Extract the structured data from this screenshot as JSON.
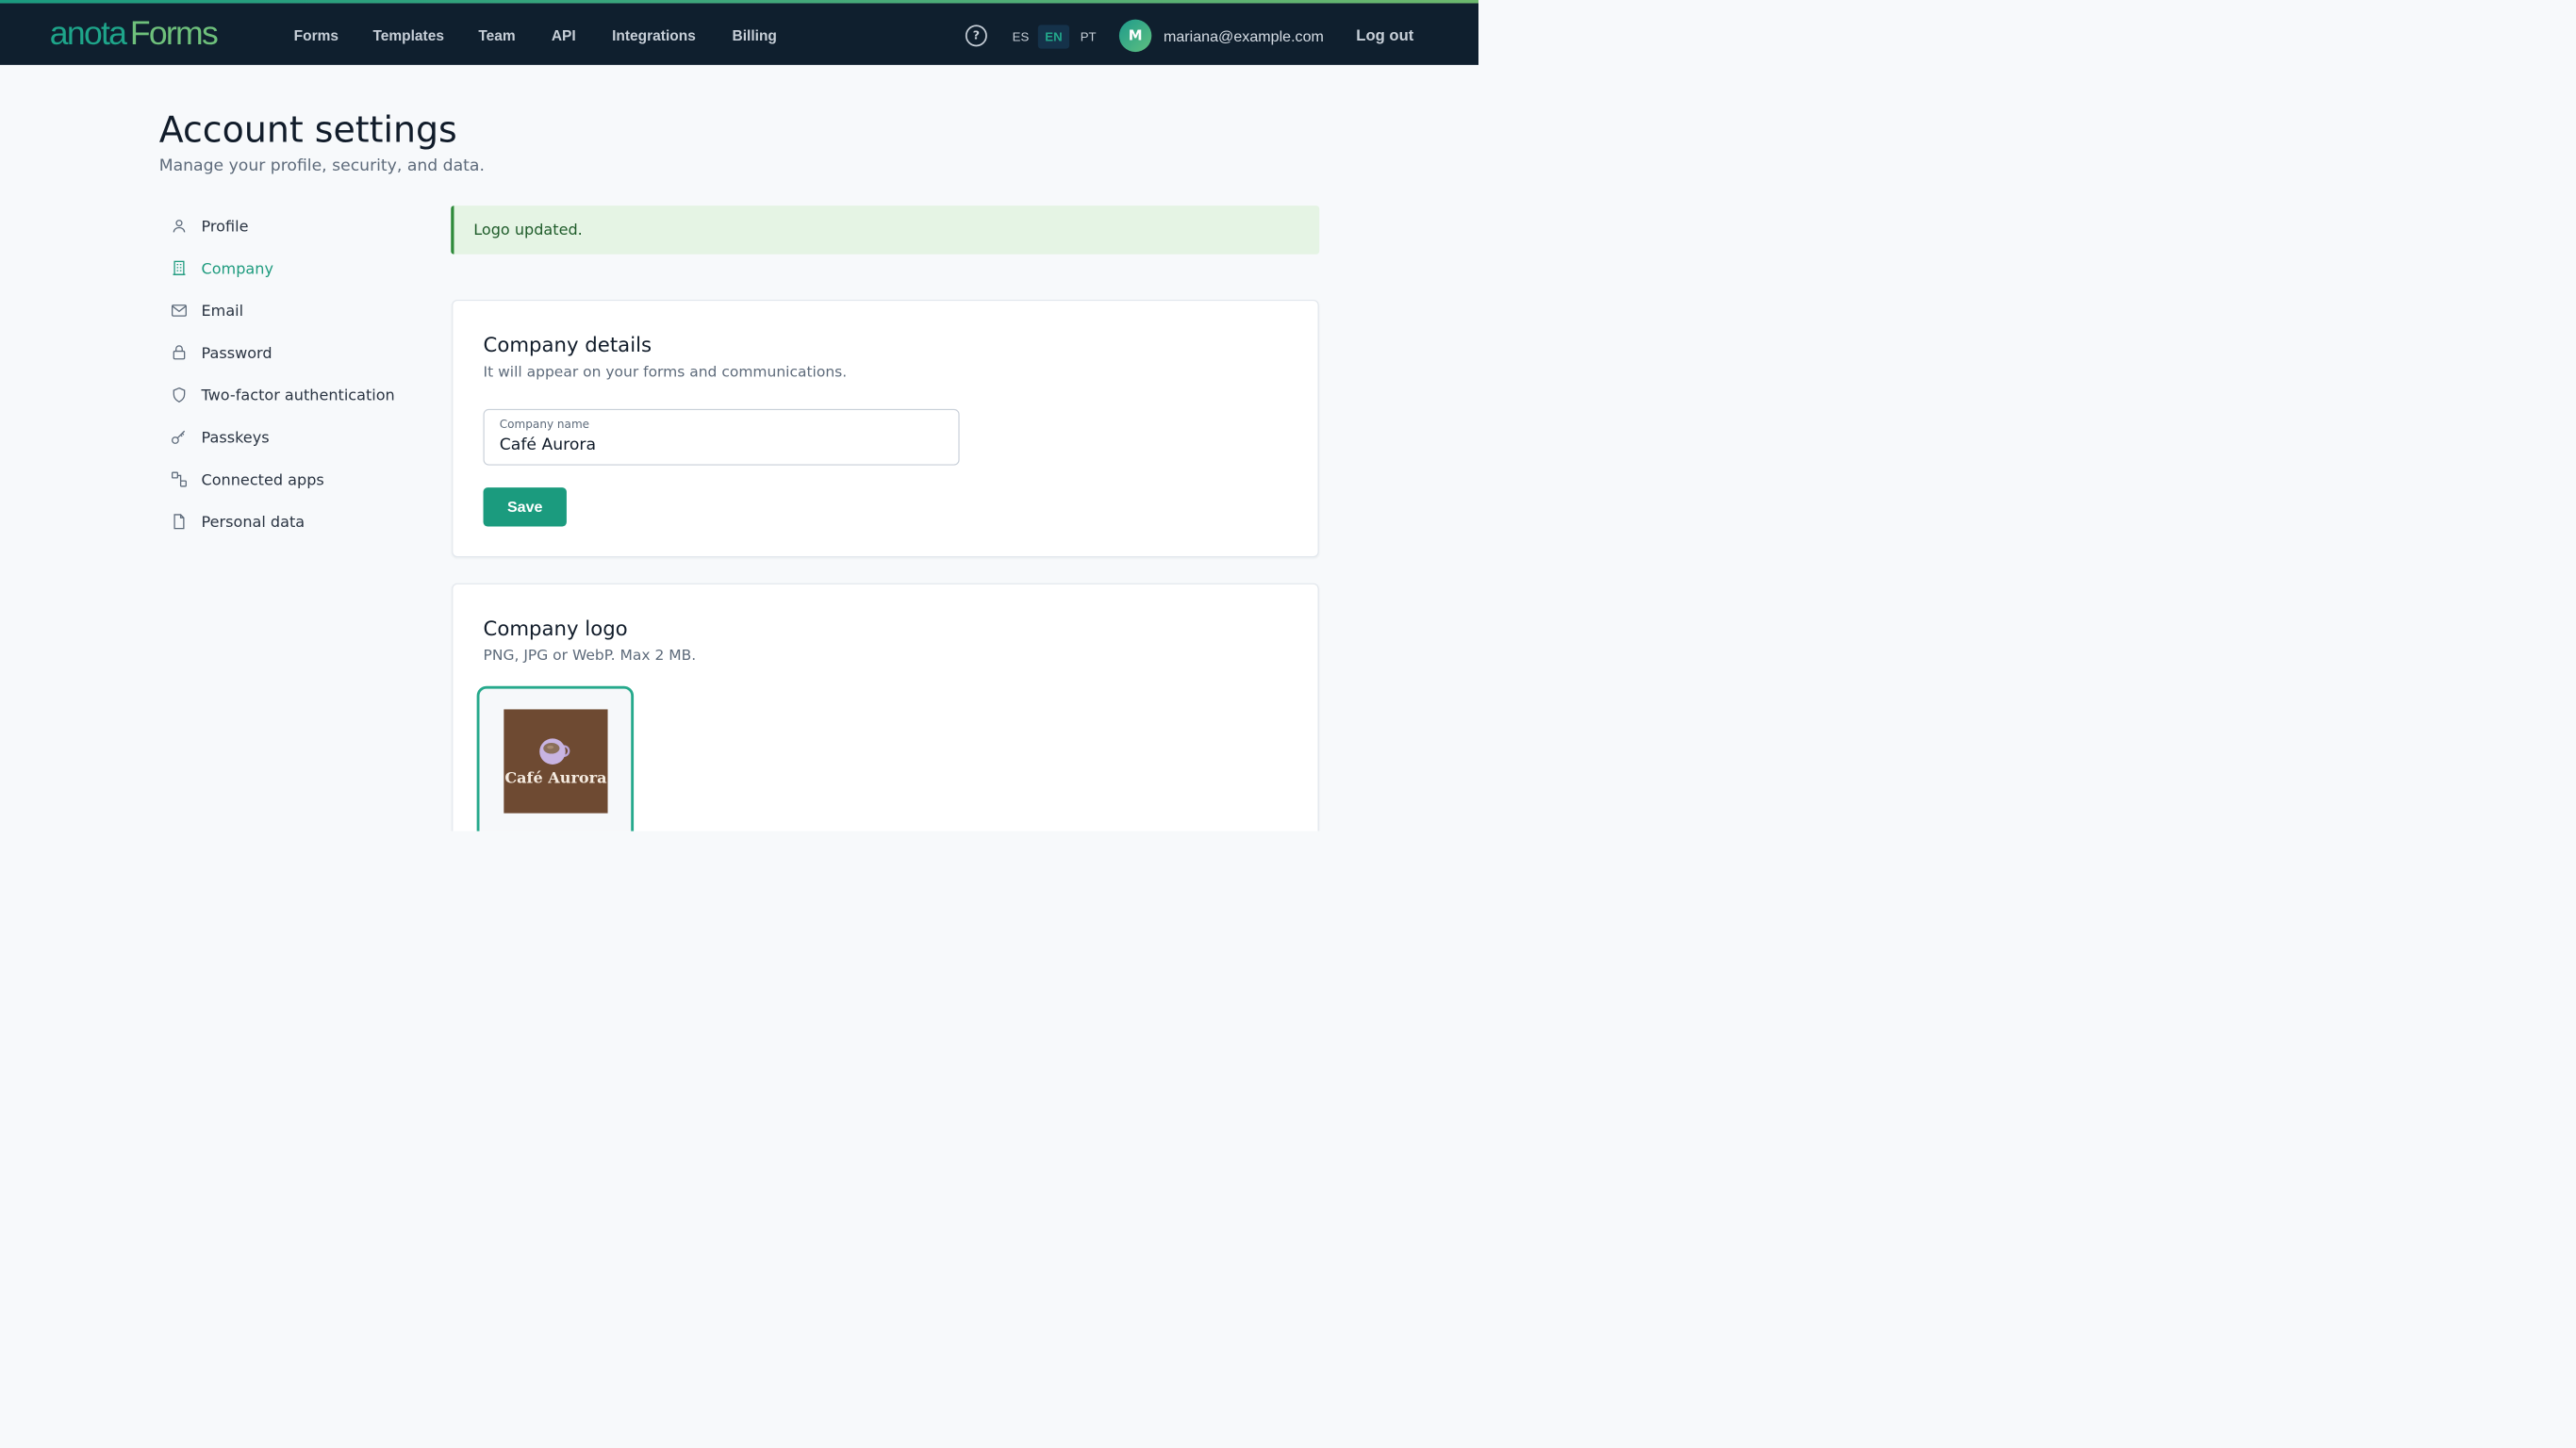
{
  "brand": {
    "part1": "anota",
    "part2": "Forms"
  },
  "nav": {
    "items": [
      {
        "label": "Forms"
      },
      {
        "label": "Templates"
      },
      {
        "label": "Team"
      },
      {
        "label": "API"
      },
      {
        "label": "Integrations"
      },
      {
        "label": "Billing"
      }
    ]
  },
  "header_right": {
    "help_glyph": "?",
    "languages": [
      {
        "code": "ES",
        "active": false
      },
      {
        "code": "EN",
        "active": true
      },
      {
        "code": "PT",
        "active": false
      }
    ],
    "avatar_initial": "M",
    "email": "mariana@example.com",
    "logout_label": "Log out"
  },
  "page": {
    "title": "Account settings",
    "subtitle": "Manage your profile, security, and data."
  },
  "sidebar": {
    "items": [
      {
        "label": "Profile",
        "icon": "user-icon",
        "active": false
      },
      {
        "label": "Company",
        "icon": "building-icon",
        "active": true
      },
      {
        "label": "Email",
        "icon": "envelope-icon",
        "active": false
      },
      {
        "label": "Password",
        "icon": "lock-icon",
        "active": false
      },
      {
        "label": "Two-factor authentication",
        "icon": "shield-icon",
        "active": false
      },
      {
        "label": "Passkeys",
        "icon": "key-icon",
        "active": false
      },
      {
        "label": "Connected apps",
        "icon": "apps-icon",
        "active": false
      },
      {
        "label": "Personal data",
        "icon": "document-icon",
        "active": false
      }
    ]
  },
  "alert": {
    "message": "Logo updated."
  },
  "company_details": {
    "title": "Company details",
    "description": "It will appear on your forms and communications.",
    "field_label": "Company name",
    "field_value": "Café Aurora",
    "save_label": "Save"
  },
  "company_logo": {
    "title": "Company logo",
    "description": "PNG, JPG or WebP. Max 2 MB.",
    "logo_text": "Café Aurora"
  },
  "colors": {
    "topbar": "#0f1f2e",
    "accent": "#1b9b7e",
    "alert_bg": "#e5f4e4",
    "alert_border": "#2e8a3a",
    "logo_bg": "#6e4a32"
  }
}
